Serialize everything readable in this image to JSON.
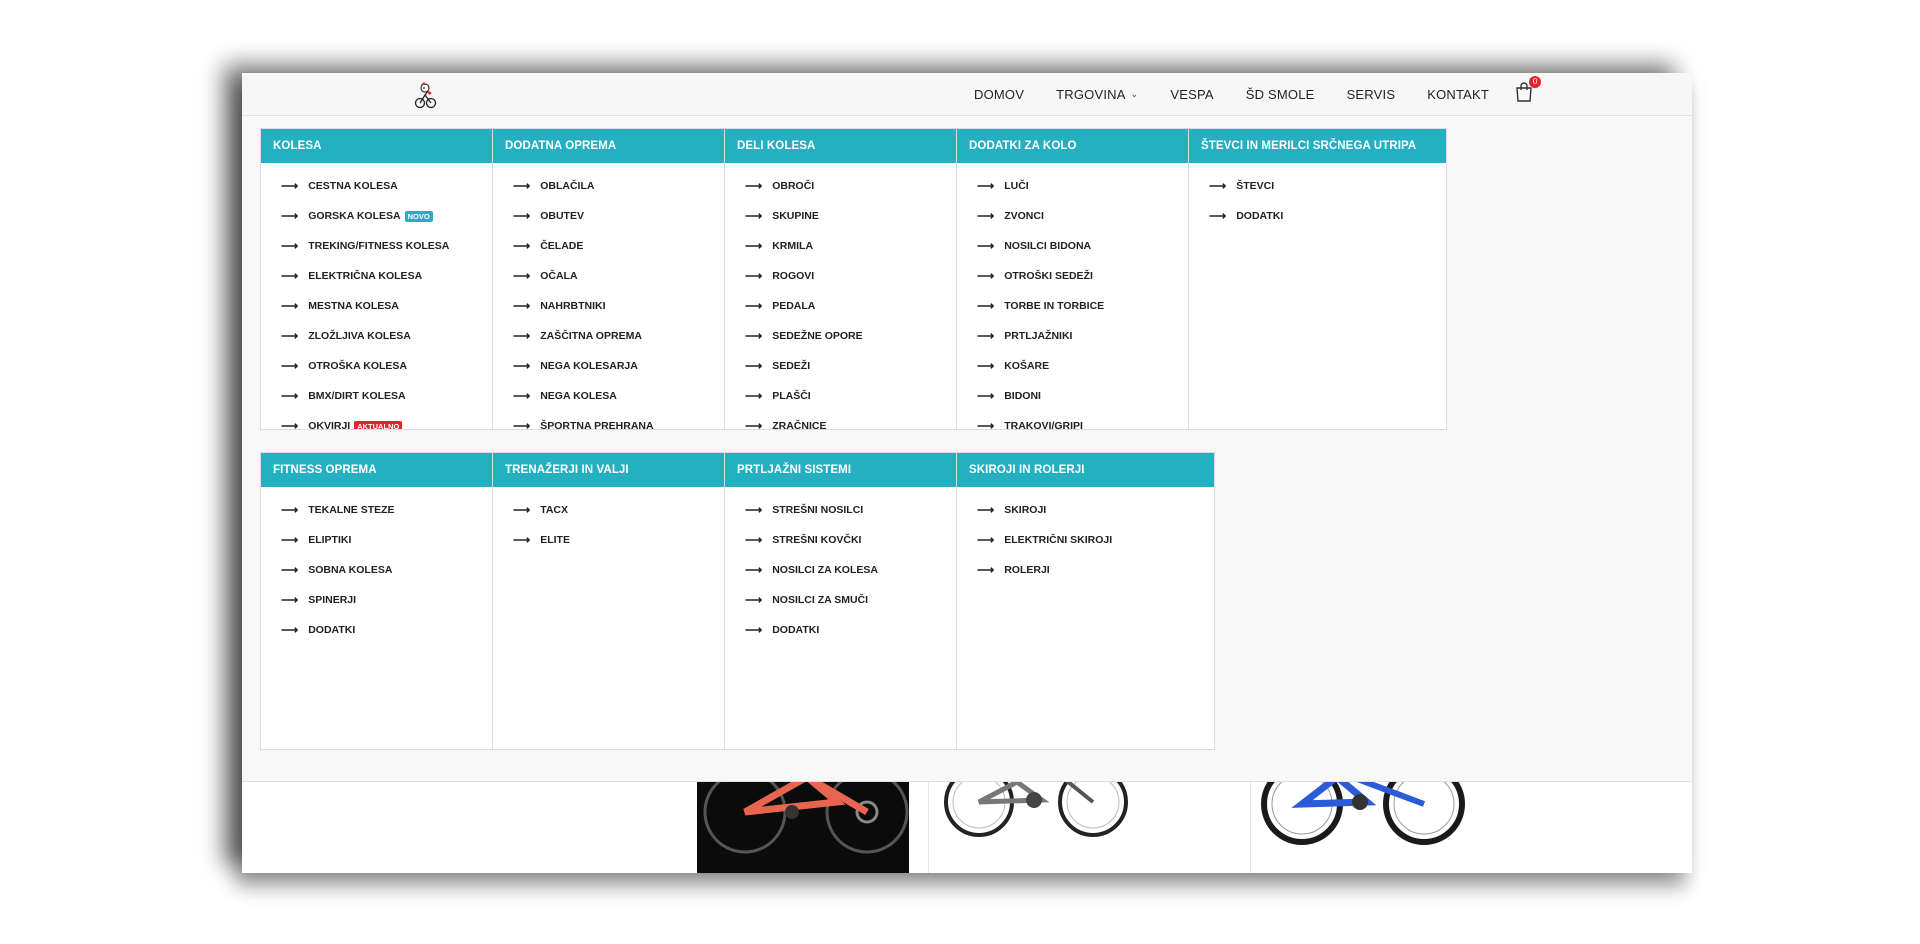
{
  "header": {
    "nav": [
      {
        "label": "DOMOV"
      },
      {
        "label": "TRGOVINA",
        "has_dropdown": true
      },
      {
        "label": "VESPA"
      },
      {
        "label": "ŠD SMOLE"
      },
      {
        "label": "SERVIS"
      },
      {
        "label": "KONTAKT"
      }
    ],
    "cart_count": "0"
  },
  "menu": {
    "row1": [
      {
        "title": "KOLESA",
        "scroll": true,
        "items": [
          {
            "label": "CESTNA KOLESA"
          },
          {
            "label": "GORSKA KOLESA",
            "badge": "NOVO",
            "badge_color": "#25b0c1"
          },
          {
            "label": "TREKING/FITNESS KOLESA"
          },
          {
            "label": "ELEKTRIČNA KOLESA"
          },
          {
            "label": "MESTNA KOLESA"
          },
          {
            "label": "ZLOŽLJIVA KOLESA"
          },
          {
            "label": "OTROŠKA KOLESA"
          },
          {
            "label": "BMX/DIRT KOLESA"
          },
          {
            "label": "OKVIRJI",
            "badge": "AKTUALNO",
            "badge_color": "#e8222c"
          }
        ]
      },
      {
        "title": "DODATNA OPREMA",
        "scroll": true,
        "items": [
          {
            "label": "OBLAČILA"
          },
          {
            "label": "OBUTEV"
          },
          {
            "label": "ČELADE"
          },
          {
            "label": "OČALA"
          },
          {
            "label": "NAHRBTNIKI"
          },
          {
            "label": "ZAŠČITNA OPREMA"
          },
          {
            "label": "NEGA KOLESARJA"
          },
          {
            "label": "NEGA KOLESA"
          },
          {
            "label": "ŠPORTNA PREHRANA"
          }
        ]
      },
      {
        "title": "DELI KOLESA",
        "scroll": true,
        "items": [
          {
            "label": "OBROČI"
          },
          {
            "label": "SKUPINE"
          },
          {
            "label": "KRMILA"
          },
          {
            "label": "ROGOVI"
          },
          {
            "label": "PEDALA"
          },
          {
            "label": "SEDEŽNE OPORE"
          },
          {
            "label": "SEDEŽI"
          },
          {
            "label": "PLAŠČI"
          },
          {
            "label": "ZRAČNICE"
          }
        ]
      },
      {
        "title": "DODATKI ZA KOLO",
        "scroll": true,
        "items": [
          {
            "label": "LUČI"
          },
          {
            "label": "ZVONCI"
          },
          {
            "label": "NOSILCI BIDONA"
          },
          {
            "label": "OTROŠKI SEDEŽI"
          },
          {
            "label": "TORBE IN TORBICE"
          },
          {
            "label": "PRTLJAŽNIKI"
          },
          {
            "label": "KOŠARE"
          },
          {
            "label": "BIDONI"
          },
          {
            "label": "TRAKOVI/GRIPI"
          }
        ]
      },
      {
        "title": "ŠTEVCI IN MERILCI SRČNEGA UTRIPA",
        "scroll": false,
        "items": [
          {
            "label": "ŠTEVCI"
          },
          {
            "label": "DODATKI"
          }
        ]
      }
    ],
    "row2": [
      {
        "title": "FITNESS OPREMA",
        "items": [
          {
            "label": "TEKALNE STEZE"
          },
          {
            "label": "ELIPTIKI"
          },
          {
            "label": "SOBNA KOLESA"
          },
          {
            "label": "SPINERJI"
          },
          {
            "label": "DODATKI"
          }
        ]
      },
      {
        "title": "TRENAŽERJI IN VALJI",
        "items": [
          {
            "label": "TACX"
          },
          {
            "label": "ELITE"
          }
        ]
      },
      {
        "title": "PRTLJAŽNI SISTEMI",
        "items": [
          {
            "label": "STREŠNI NOSILCI"
          },
          {
            "label": "STREŠNI KOVČKI"
          },
          {
            "label": "NOSILCI ZA KOLESA"
          },
          {
            "label": "NOSILCI ZA SMUČI"
          },
          {
            "label": "DODATKI"
          }
        ]
      },
      {
        "title": "SKIROJI IN ROLERJI",
        "items": [
          {
            "label": "SKIROJI"
          },
          {
            "label": "ELEKTRIČNI SKIROJI"
          },
          {
            "label": "ROLERJI"
          }
        ]
      }
    ]
  },
  "colors": {
    "accent": "#25b0c1",
    "badge_red": "#e8222c"
  }
}
